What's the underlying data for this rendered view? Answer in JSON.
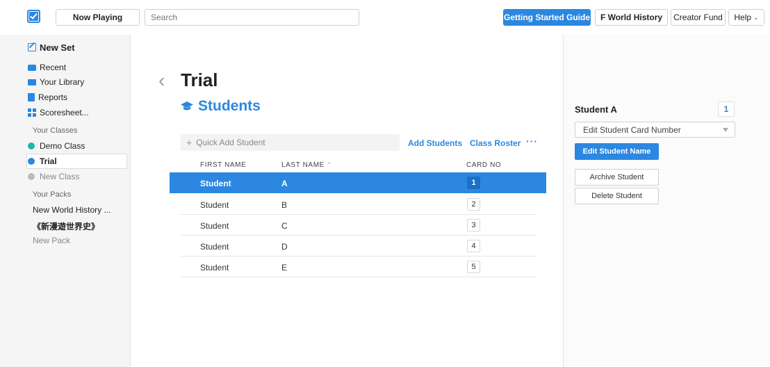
{
  "topbar": {
    "now_playing": "Now Playing",
    "search_placeholder": "Search",
    "getting_started": "Getting Started Guide",
    "f_world_history": "F World History",
    "creator_fund": "Creator Fund",
    "help": "Help",
    "accent_color": "#2b87e0"
  },
  "sidebar": {
    "new_set": "New Set",
    "recent": "Recent",
    "your_library": "Your Library",
    "reports": "Reports",
    "scoresheet": "Scoresheet...",
    "your_classes_heading": "Your Classes",
    "classes": [
      "Demo Class",
      "Trial"
    ],
    "new_class": "New Class",
    "your_packs_heading": "Your Packs",
    "packs": [
      "New World History ...",
      "《新漫遊世界史》"
    ],
    "new_pack": "New Pack"
  },
  "main": {
    "title": "Trial",
    "subtitle": "Students",
    "quick_add_placeholder": "Quick Add Student",
    "add_students": "Add Students",
    "class_roster": "Class Roster",
    "more": "···",
    "columns": {
      "first_name": "FIRST NAME",
      "last_name": "LAST NAME",
      "card_no": "CARD NO"
    },
    "rows": [
      {
        "first": "Student",
        "last": "A",
        "card": "1",
        "selected": true
      },
      {
        "first": "Student",
        "last": "B",
        "card": "2"
      },
      {
        "first": "Student",
        "last": "C",
        "card": "3"
      },
      {
        "first": "Student",
        "last": "D",
        "card": "4"
      },
      {
        "first": "Student",
        "last": "E",
        "card": "5"
      }
    ]
  },
  "panel": {
    "student_name": "Student A",
    "card_number": "1",
    "edit_card_number": "Edit Student Card Number",
    "edit_name": "Edit Student Name",
    "archive": "Archive Student",
    "delete": "Delete Student"
  }
}
